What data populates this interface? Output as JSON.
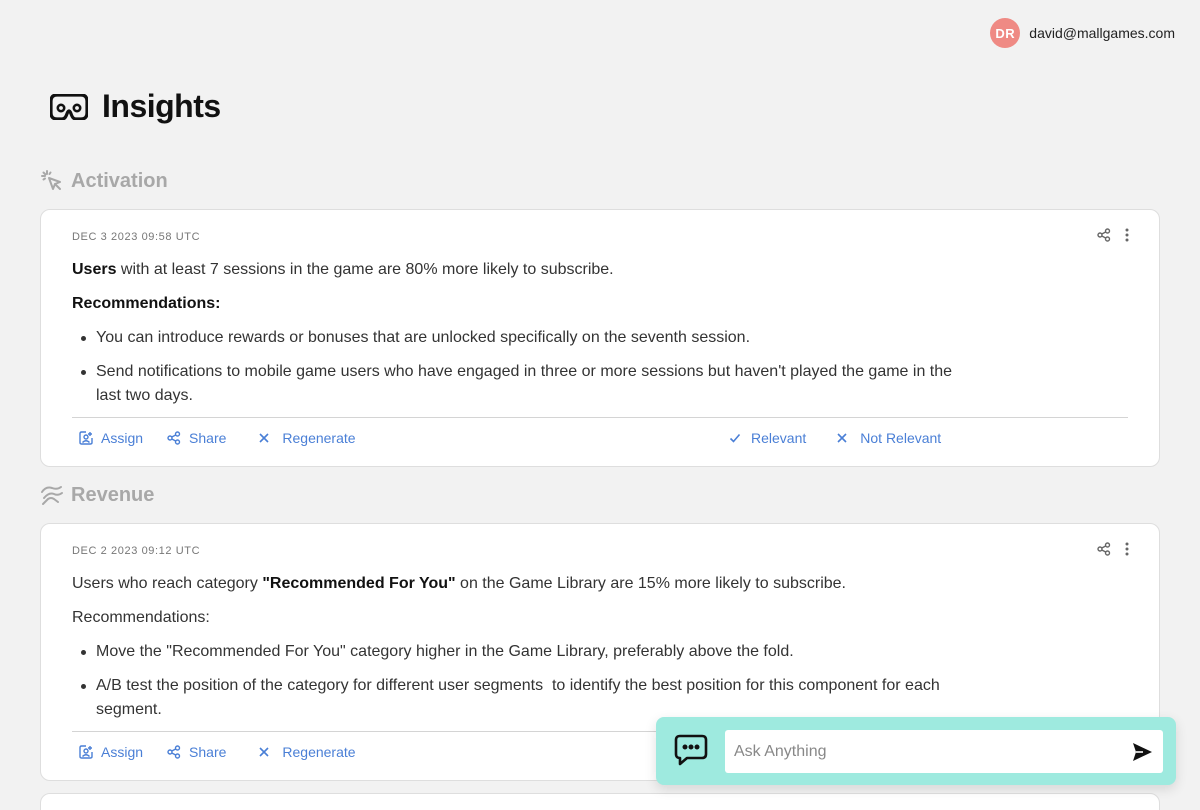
{
  "user": {
    "initials": "DR",
    "email": "david@mallgames.com",
    "avatar_color": "#ef8a84"
  },
  "page": {
    "title": "Insights",
    "icon": "vr-headset-icon"
  },
  "sections": [
    {
      "title": "Activation",
      "icon": "cursor-click-icon",
      "card": {
        "date": "DEC 3 2023 09:58 UTC",
        "headline_bold": "Users",
        "headline_rest": " with at least 7 sessions in the game are 80% more likely to subscribe.",
        "recommendations_label": "Recommendations:",
        "recommendations": [
          "You can introduce rewards or bonuses that are unlocked specifically on the seventh session.",
          "Send notifications to mobile game users who have engaged in three or more sessions but haven't played the game in the last two days."
        ],
        "actions": {
          "assign": "Assign",
          "share": "Share",
          "regenerate": "Regenerate",
          "relevant": "Relevant",
          "not_relevant": "Not Relevant"
        }
      }
    },
    {
      "title": "Revenue",
      "icon": "handshake-icon",
      "card": {
        "date": "DEC 2 2023 09:12 UTC",
        "headline_pre": "Users who reach category ",
        "headline_bold": "\"Recommended For You\"",
        "headline_post": " on the Game Library are 15% more likely to subscribe.",
        "recommendations_label": "Recommendations:",
        "recommendations": [
          "Move the \"Recommended For You\" category higher in the Game Library, preferably above the fold.",
          "A/B test the position of the category for different user segments  to identify the best position for this component for each segment."
        ],
        "actions": {
          "assign": "Assign",
          "share": "Share",
          "regenerate": "Regenerate"
        }
      }
    }
  ],
  "chat": {
    "placeholder": "Ask Anything",
    "value": ""
  },
  "colors": {
    "accent": "#4a7fd6",
    "chat_bg": "#9eeadf",
    "section_title": "#a8a8a8"
  }
}
